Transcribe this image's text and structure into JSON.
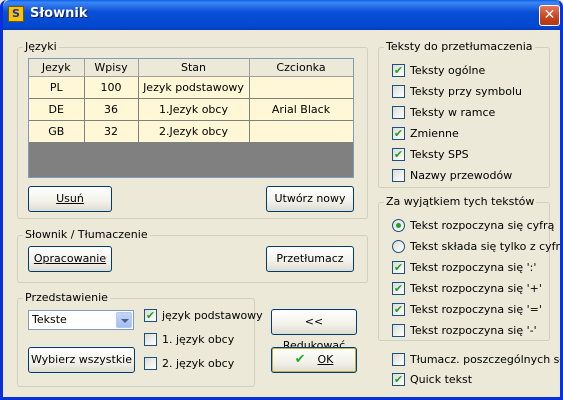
{
  "window": {
    "title": "Słownik",
    "app_icon_glyph": "S",
    "close_glyph": "✕"
  },
  "languages": {
    "legend": "Języki",
    "columns": [
      "Jezyk",
      "Wpisy",
      "Stan",
      "Czcionka"
    ],
    "rows": [
      [
        "PL",
        "100",
        "Jezyk podstawowy",
        ""
      ],
      [
        "DE",
        "36",
        "1.Jezyk obcy",
        "Arial Black"
      ],
      [
        "GB",
        "32",
        "2.Jezyk obcy",
        ""
      ]
    ],
    "remove_label": "Usuń",
    "create_label": "Utwórz nowy"
  },
  "dictionary": {
    "legend": "Słownik / Tłumaczenie",
    "edit_label": "Opracowanie",
    "translate_label": "Przetłumacz"
  },
  "display": {
    "legend": "Przedstawienie",
    "select_value": "Tekste",
    "select_all_label": "Wybierz wszystkie",
    "options": [
      {
        "label": "język podstawowy",
        "checked": true
      },
      {
        "label": "1. język obcy",
        "checked": false
      },
      {
        "label": "2. język obcy",
        "checked": false
      }
    ]
  },
  "reduce_label": "<< Redukować",
  "ok_label": "OK",
  "texts": {
    "legend": "Teksty do przetłumaczenia",
    "items": [
      {
        "label": "Teksty ogólne",
        "checked": true
      },
      {
        "label": "Teksty przy symbolu",
        "checked": false
      },
      {
        "label": "Teksty w ramce",
        "checked": false
      },
      {
        "label": "Zmienne",
        "checked": true
      },
      {
        "label": "Teksty SPS",
        "checked": true
      },
      {
        "label": "Nazwy przewodów",
        "checked": false
      }
    ]
  },
  "exceptions": {
    "legend": "Za wyjątkiem tych tekstów",
    "radios": [
      {
        "label": "Tekst rozpoczyna się cyfrą",
        "selected": true
      },
      {
        "label": "Tekst składa się tylko z cyfr",
        "selected": false
      }
    ],
    "checks": [
      {
        "label": "Tekst rozpoczyna się ':'",
        "checked": true
      },
      {
        "label": "Tekst rozpoczyna się '+'",
        "checked": true
      },
      {
        "label": "Tekst rozpoczyna się '='",
        "checked": true
      },
      {
        "label": "Tekst rozpoczyna się '-'",
        "checked": false
      }
    ]
  },
  "bottom_options": [
    {
      "label": "Tłumacz. poszczególnych słów",
      "checked": false
    },
    {
      "label": "Quick tekst",
      "checked": true
    }
  ],
  "colors": {
    "titlebar": "#0a4fd6",
    "window_bg": "#ece9d8",
    "grid_row": "#fff7d6",
    "check": "#21a121"
  }
}
